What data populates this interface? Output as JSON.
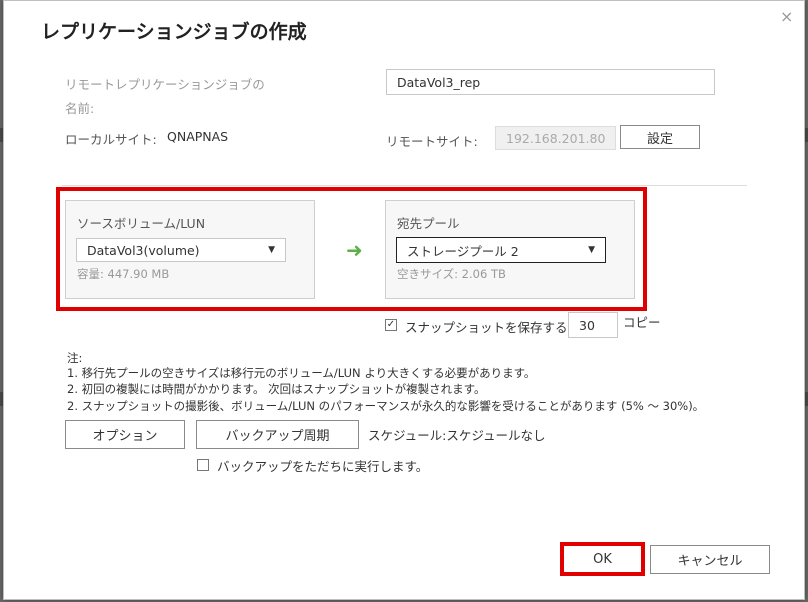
{
  "dialog": {
    "title": "レプリケーションジョブの作成",
    "close_glyph": "×"
  },
  "job_name": {
    "label_line1": "リモートレプリケーションジョブの",
    "label_line2": "名前:",
    "value": "DataVol3_rep"
  },
  "local_site": {
    "label": "ローカルサイト:",
    "value": "QNAPNAS"
  },
  "remote_site": {
    "label": "リモートサイト:",
    "value": "192.168.201.80",
    "settings_label": "設定"
  },
  "source": {
    "label": "ソースボリューム/LUN",
    "selected": "DataVol3(volume)",
    "capacity": "容量: 447.90 MB"
  },
  "destination": {
    "label": "宛先プール",
    "selected": "ストレージプール 2",
    "free_space": "空きサイズ: 2.06 TB"
  },
  "snapshot": {
    "checked": true,
    "label": "スナップショットを保存する",
    "count": "30",
    "unit": "コピー"
  },
  "notes": {
    "heading": "注:",
    "lines": [
      "1. 移行先プールの空きサイズは移行元のボリューム/LUN より大きくする必要があります。",
      "2. 初回の複製には時間がかかります。 次回はスナップショットが複製されます。",
      "2. スナップショットの撮影後、ボリューム/LUN のパフォーマンスが永久的な影響を受けることがあります (5% ～ 30%)。"
    ]
  },
  "options_button": "オプション",
  "backup_schedule_button": "バックアップ周期",
  "schedule_text": "スケジュール:スケジュールなし",
  "run_now": {
    "checked": false,
    "label": "バックアップをただちに実行します。"
  },
  "ok_button": "OK",
  "cancel_button": "キャンセル",
  "colors": {
    "highlight": "#e00000",
    "arrow": "#5bb04a"
  },
  "icons": {
    "arrow": "arrow-right-icon",
    "caret": "chevron-down-icon",
    "close": "close-icon",
    "check": "checkmark-icon"
  }
}
